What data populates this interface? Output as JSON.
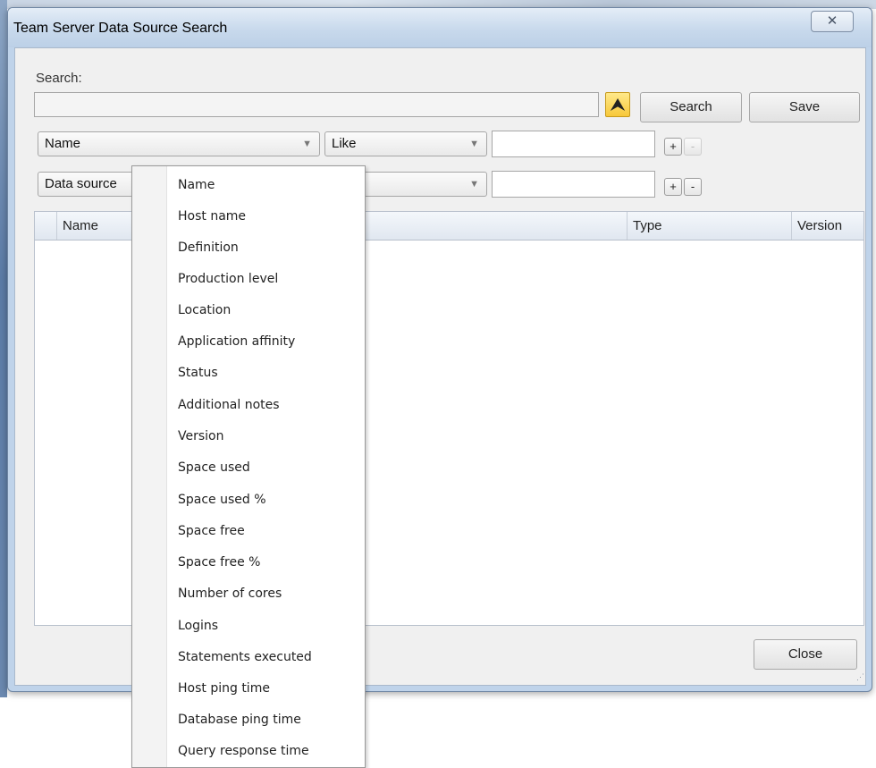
{
  "window": {
    "title": "Team Server Data Source Search",
    "close_glyph": "✕"
  },
  "search": {
    "label": "Search:",
    "query_value": "",
    "collapse_glyph": "⮝",
    "search_button": "Search",
    "save_button": "Save"
  },
  "criteria": [
    {
      "field": "Name",
      "operator": "Like",
      "value": "",
      "add": "+",
      "remove": "-",
      "remove_enabled": false
    },
    {
      "field": "Data source",
      "operator": "",
      "value": "",
      "add": "+",
      "remove": "-",
      "remove_enabled": true
    }
  ],
  "grid": {
    "columns": [
      "Name",
      "Type",
      "Version"
    ],
    "rows": []
  },
  "footer": {
    "close_button": "Close"
  },
  "dropdown": {
    "items": [
      "Name",
      "Host name",
      "Definition",
      "Production level",
      "Location",
      "Application affinity",
      "Status",
      "Additional notes",
      "Version",
      "Space used",
      "Space used %",
      "Space free",
      "Space free %",
      "Number of cores",
      "Logins",
      "Statements executed",
      "Host ping time",
      "Database ping time",
      "Query response time"
    ]
  },
  "colors": {
    "accent_button": "#f7c83a",
    "window_frame": "#bfd3ea"
  }
}
